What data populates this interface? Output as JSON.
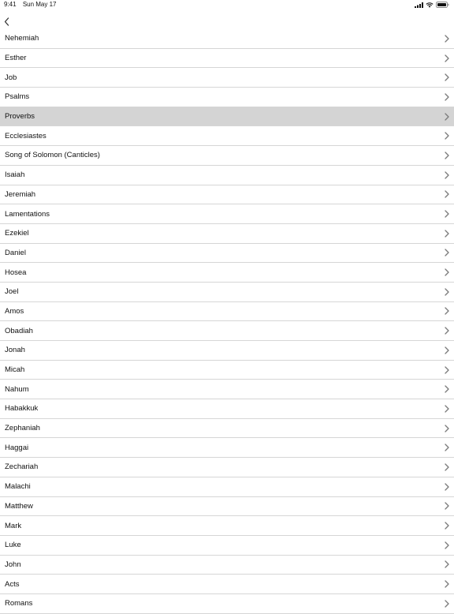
{
  "status": {
    "time": "9:41",
    "date": "Sun May 17"
  },
  "colors": {
    "selected_row": "#d4d4d4",
    "separator": "#d6d6d6",
    "chevron": "#7a7a7a"
  },
  "list": {
    "selected_index": 4,
    "items": [
      "Nehemiah",
      "Esther",
      "Job",
      "Psalms",
      "Proverbs",
      "Ecclesiastes",
      "Song of Solomon (Canticles)",
      "Isaiah",
      "Jeremiah",
      "Lamentations",
      "Ezekiel",
      "Daniel",
      "Hosea",
      "Joel",
      "Amos",
      "Obadiah",
      "Jonah",
      "Micah",
      "Nahum",
      "Habakkuk",
      "Zephaniah",
      "Haggai",
      "Zechariah",
      "Malachi",
      "Matthew",
      "Mark",
      "Luke",
      "John",
      "Acts",
      "Romans"
    ]
  }
}
